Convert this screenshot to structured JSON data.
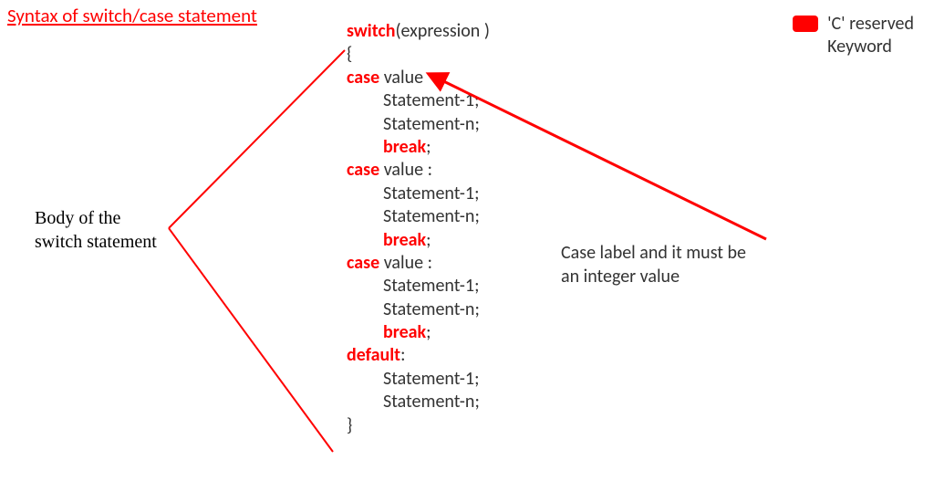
{
  "title": "Syntax of switch/case statement",
  "legend": {
    "text1": "'C' reserved",
    "text2": "Keyword"
  },
  "left_annotation": {
    "line1": "Body of the",
    "line2": "switch statement"
  },
  "right_annotation": {
    "line1": "Case label and it must be",
    "line2": "an integer value"
  },
  "code": {
    "kw_switch": "switch",
    "expr": "(expression )",
    "brace_open": "{",
    "kw_case": "case",
    "value_colon": " value :",
    "value_short": " value",
    "stmt1": "Statement-1;",
    "stmtn": "Statement-n;",
    "kw_break": "break",
    "semi": ";",
    "kw_default": "default",
    "colon": ":",
    "brace_close": "}"
  },
  "colors": {
    "keyword": "#ff0000",
    "text": "#333333"
  }
}
